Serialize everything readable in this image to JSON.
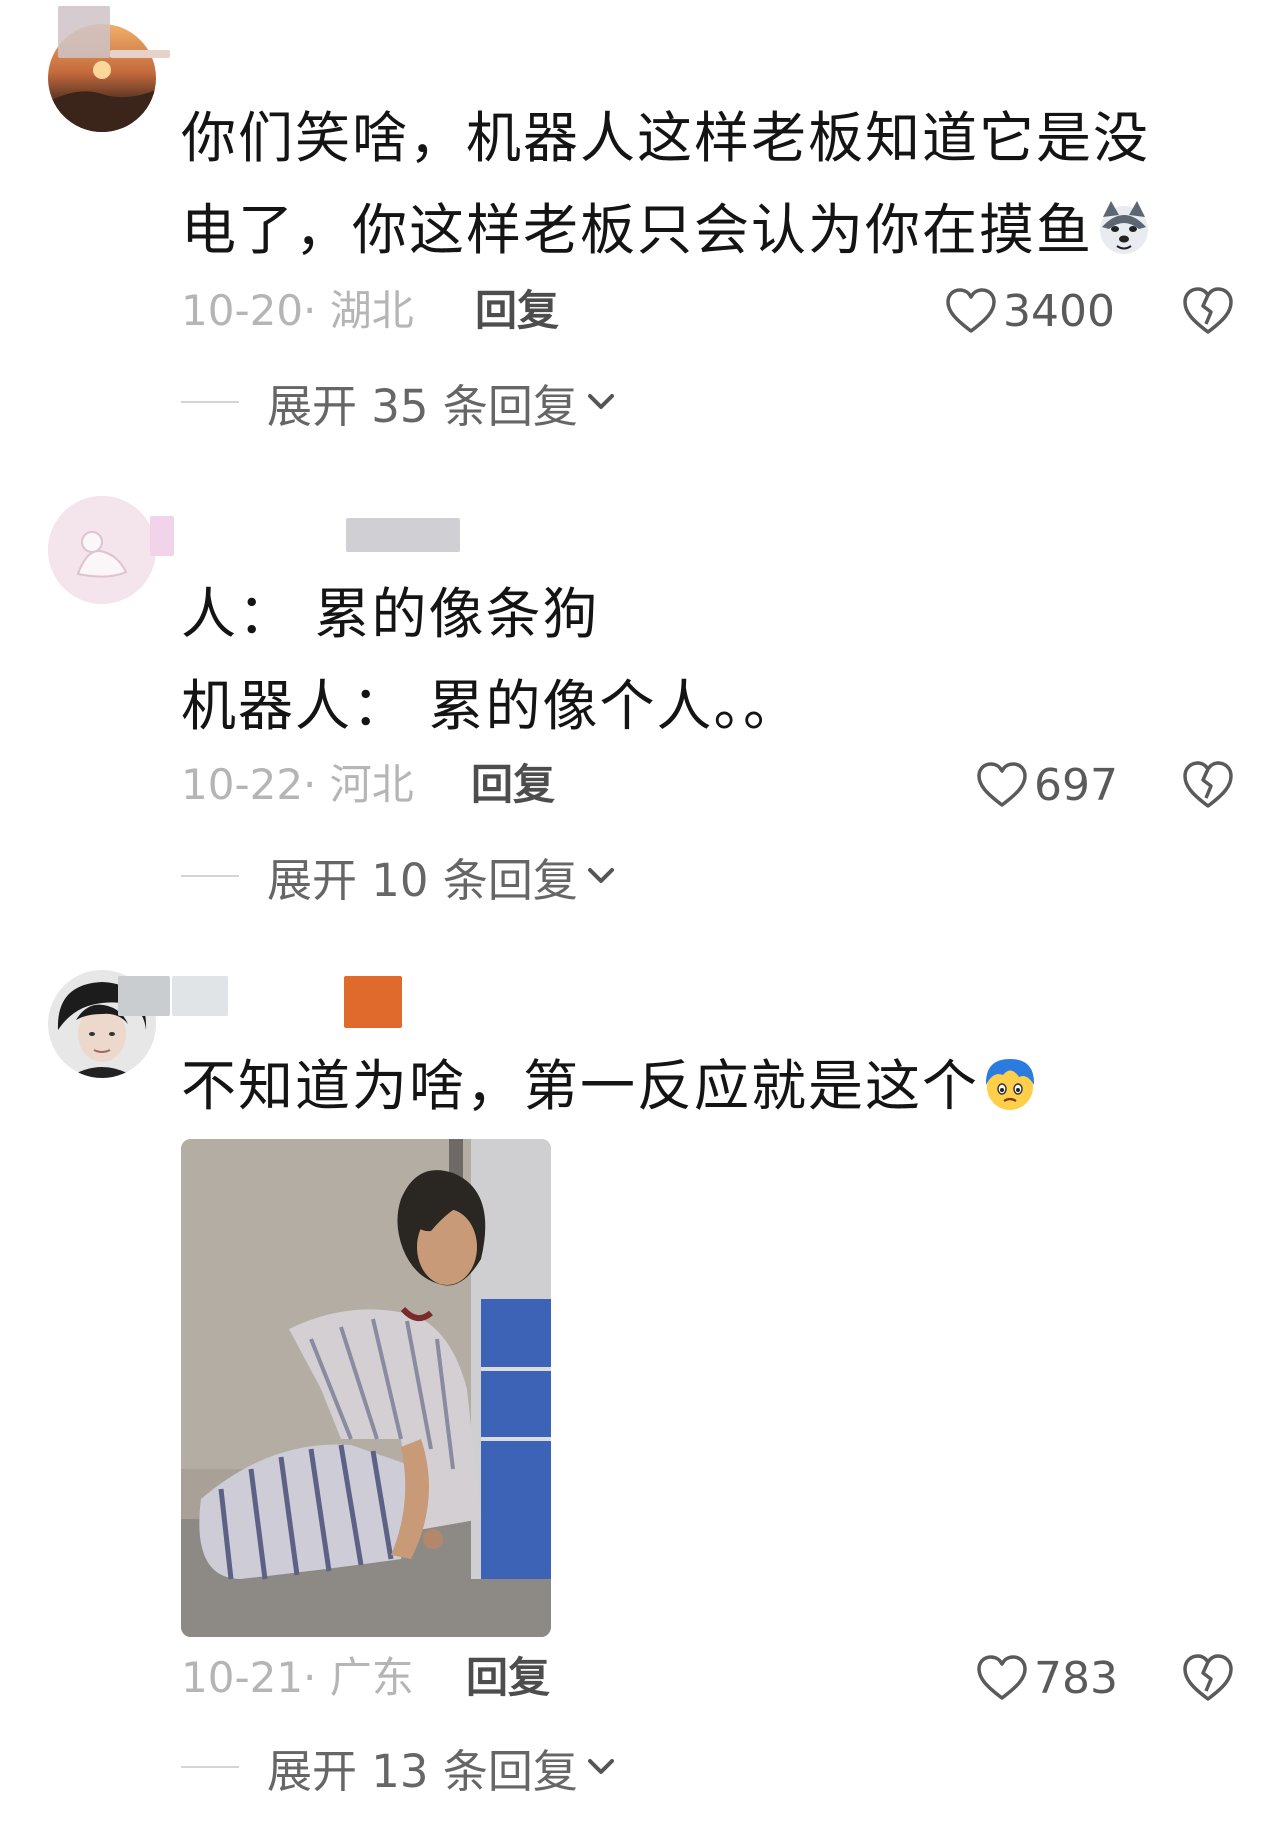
{
  "comments": [
    {
      "text_lines": [
        "你们笑啥，机器人这样老板知道它是没",
        "电了，你这样老板只会认为你在摸鱼"
      ],
      "emoji": "husky-dog-emoji",
      "date": "10-20",
      "location": "· 湖北",
      "reply_label": "回复",
      "likes": "3400",
      "expand_label": "展开 35 条回复"
    },
    {
      "text_lines": [
        "人：  累的像条狗",
        "机器人：  累的像个人。。"
      ],
      "date": "10-22",
      "location": "· 河北",
      "reply_label": "回复",
      "likes": "697",
      "expand_label": "展开 10 条回复"
    },
    {
      "text_lines": [
        "不知道为啥，第一反应就是这个"
      ],
      "emoji": "flushed-blue-hair-emoji",
      "has_photo": true,
      "date": "10-21",
      "location": "· 广东",
      "reply_label": "回复",
      "likes": "783",
      "expand_label": "展开 13 条回复"
    }
  ],
  "colors": {
    "background": "#ffffff",
    "text": "#141414",
    "meta": "#b5b5b5",
    "reply": "#4d4d4d",
    "like": "#5a5a5a",
    "name_accent": "#e06a2c"
  },
  "icons": [
    "heart-outline-icon",
    "broken-heart-icon",
    "chevron-down-icon"
  ]
}
